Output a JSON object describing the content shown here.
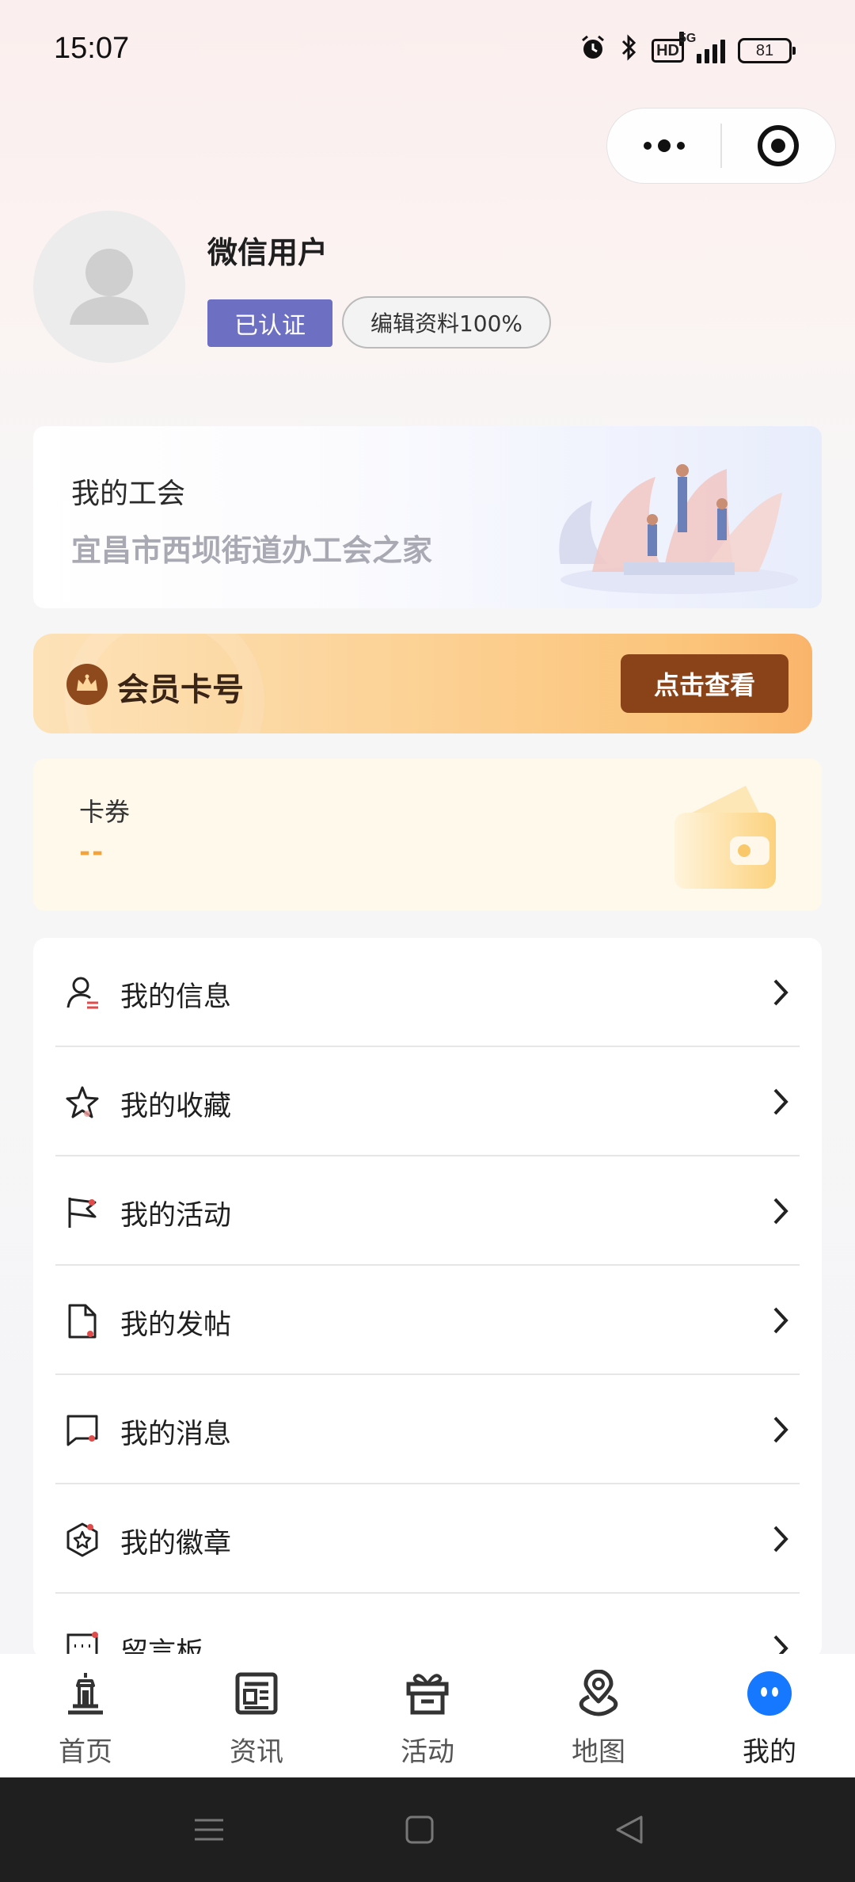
{
  "status_bar": {
    "time": "15:07",
    "network": "5G",
    "hd_label": "HD",
    "battery": "81",
    "icons": [
      "alarm-icon",
      "bluetooth-icon",
      "hd-icon",
      "signal-icon",
      "battery-icon"
    ]
  },
  "capsule": {
    "more_icon": "more-dots-icon",
    "close_icon": "target-circle-icon"
  },
  "profile": {
    "username": "微信用户",
    "verified_label": "已认证",
    "edit_label": "编辑资料100%"
  },
  "union": {
    "title": "我的工会",
    "name": "宜昌市西坝街道办工会之家"
  },
  "member": {
    "label": "会员卡号",
    "button": "点击查看"
  },
  "coupon": {
    "title": "卡券",
    "value": "--"
  },
  "menu": [
    {
      "label": "我的信息",
      "icon": "user-info-icon"
    },
    {
      "label": "我的收藏",
      "icon": "star-icon"
    },
    {
      "label": "我的活动",
      "icon": "flag-icon"
    },
    {
      "label": "我的发帖",
      "icon": "document-icon"
    },
    {
      "label": "我的消息",
      "icon": "message-icon"
    },
    {
      "label": "我的徽章",
      "icon": "badge-icon"
    },
    {
      "label": "留言板",
      "icon": "message-board-icon"
    }
  ],
  "tabs": [
    {
      "label": "首页",
      "icon": "home-tower-icon",
      "active": false
    },
    {
      "label": "资讯",
      "icon": "news-icon",
      "active": false
    },
    {
      "label": "活动",
      "icon": "gift-icon",
      "active": false
    },
    {
      "label": "地图",
      "icon": "map-pin-icon",
      "active": false
    },
    {
      "label": "我的",
      "icon": "profile-face-icon",
      "active": true
    }
  ],
  "colors": {
    "accent_blue": "#1677ff",
    "verified_purple": "#6d6fc2",
    "member_button_brown": "#8a4218",
    "coupon_orange": "#f2a43a"
  }
}
